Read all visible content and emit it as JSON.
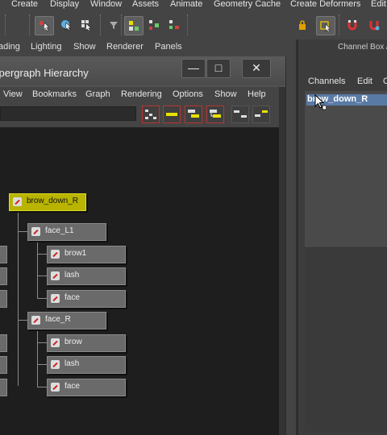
{
  "main_menu": [
    "Create",
    "Display",
    "Window",
    "Assets",
    "Animate",
    "Geometry Cache",
    "Create Deformers",
    "Edit"
  ],
  "panel_menu": [
    "ading",
    "Lighting",
    "Show",
    "Renderer",
    "Panels"
  ],
  "channel_box": {
    "title": "Channel Box /",
    "menu": [
      "Channels",
      "Edit",
      "O"
    ],
    "selected_object": "brow_down_R"
  },
  "hypergraph": {
    "title": "ypergraph Hierarchy",
    "window_buttons": [
      "minimize-icon",
      "maximize-icon",
      "close-icon"
    ],
    "menu": [
      "View",
      "Bookmarks",
      "Graph",
      "Rendering",
      "Options",
      "Show",
      "Help"
    ],
    "nodes": {
      "root": "brow_down_R",
      "face_L1": "face_L1",
      "brow1": "brow1",
      "lash_l": "lash",
      "face_l": "face",
      "face_R": "face_R",
      "brow_r": "brow",
      "lash_r": "lash",
      "face_r": "face"
    }
  },
  "colors": {
    "selected_node": "#b8b400",
    "selection_highlight": "#5a7aa6",
    "canvas": "#1e1e1e"
  }
}
